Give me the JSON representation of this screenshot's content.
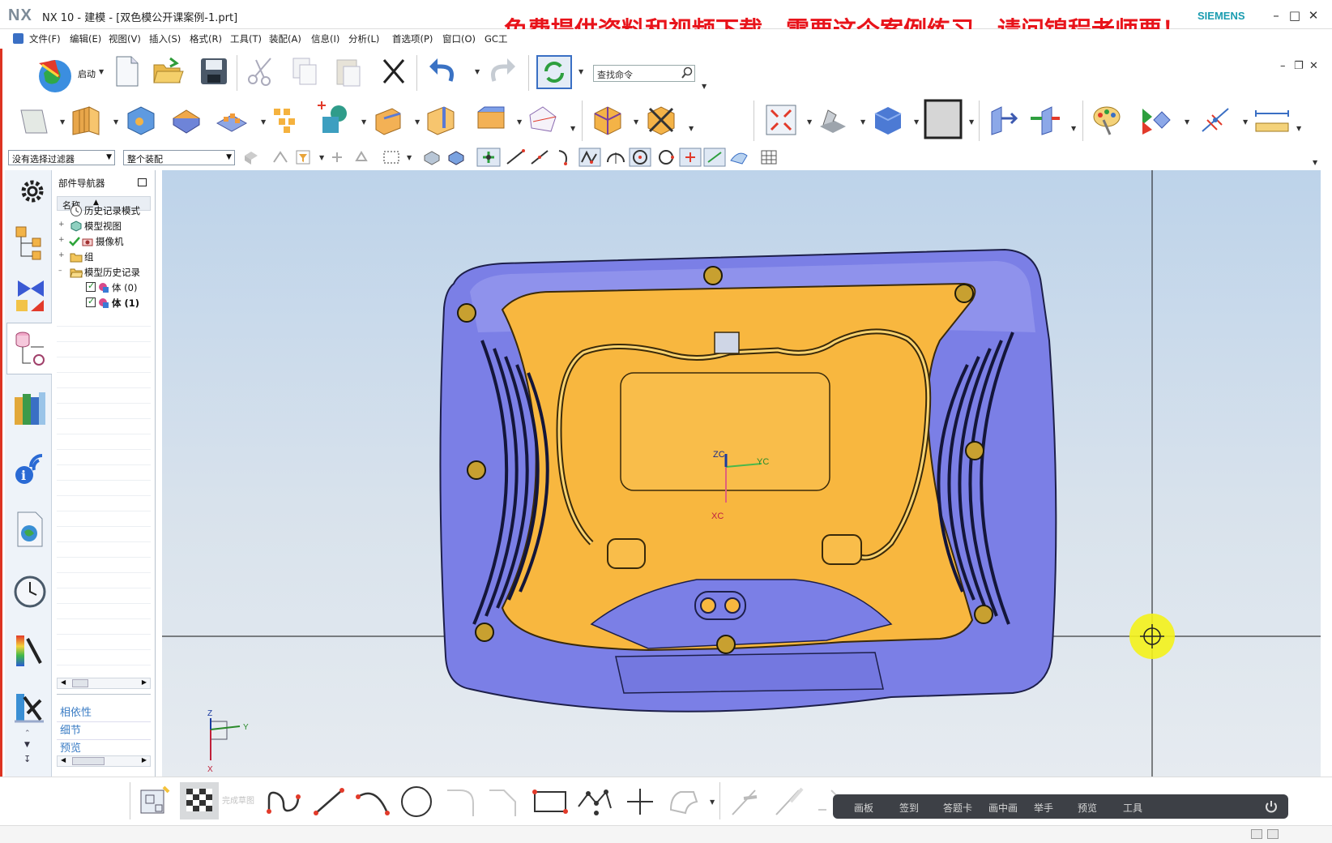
{
  "window": {
    "logo": "NX",
    "title": "NX 10 - 建模 - [双色模公开课案例-1.prt]",
    "brand": "SIEMENS",
    "banner": "免费提供资料和视频下载，需要这个案例练习，请问锦程老师要！"
  },
  "menu": [
    "文件(F)",
    "编辑(E)",
    "视图(V)",
    "插入(S)",
    "格式(R)",
    "工具(T)",
    "装配(A)",
    "信息(I)",
    "分析(L)",
    "首选项(P)",
    "窗口(O)",
    "GC工"
  ],
  "toolbar": {
    "start_label": "启动",
    "search_placeholder": "查找命令"
  },
  "selection": {
    "filter_value": "没有选择过滤器",
    "scope_value": "整个装配"
  },
  "navigator": {
    "title": "部件导航器",
    "column_header": "名称",
    "items": [
      {
        "label": "历史记录模式",
        "icon": "clock-icon"
      },
      {
        "label": "模型视图",
        "icon": "model-views-icon"
      },
      {
        "label": "摄像机",
        "icon": "camera-icon"
      },
      {
        "label": "组",
        "icon": "folder-icon"
      },
      {
        "label": "模型历史记录",
        "icon": "folder-icon"
      },
      {
        "label": "体 (0)",
        "icon": "body-icon"
      },
      {
        "label": "体 (1)",
        "icon": "body-icon"
      }
    ],
    "panels": [
      "相依性",
      "细节",
      "预览"
    ]
  },
  "viewport": {
    "axes": {
      "zc": "ZC",
      "yc": "YC",
      "xc": "XC"
    },
    "triad": {
      "z": "Z",
      "y": "Y",
      "x": "X"
    },
    "colors": {
      "housing": "#7b7fe6",
      "panel": "#f8b73f",
      "background_top": "#bdd3ea"
    }
  },
  "sketch_toolbar": {
    "finish_label": "完成草图"
  },
  "meeting_bar": {
    "items": [
      "画板",
      "签到",
      "答题卡",
      "画中画",
      "举手",
      "预览",
      "工具"
    ]
  }
}
